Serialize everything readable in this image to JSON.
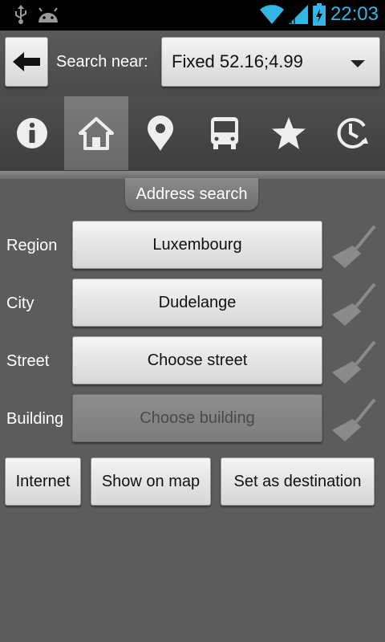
{
  "status_bar": {
    "time": "22:03",
    "icons": [
      "usb-icon",
      "android-icon",
      "wifi-icon",
      "signal-icon",
      "battery-charging-icon"
    ]
  },
  "top_bar": {
    "back_icon": "arrow-left-icon",
    "search_near_label": "Search near:",
    "location_value": "Fixed 52.16;4.99"
  },
  "tabs": [
    {
      "icon": "info-icon",
      "active": false
    },
    {
      "icon": "home-icon",
      "active": true
    },
    {
      "icon": "map-pin-icon",
      "active": false
    },
    {
      "icon": "bus-icon",
      "active": false
    },
    {
      "icon": "star-icon",
      "active": false
    },
    {
      "icon": "history-icon",
      "active": false
    }
  ],
  "section_title": "Address search",
  "fields": [
    {
      "label": "Region",
      "value": "Luxembourg",
      "enabled": true
    },
    {
      "label": "City",
      "value": "Dudelange",
      "enabled": true
    },
    {
      "label": "Street",
      "value": "Choose street",
      "enabled": true
    },
    {
      "label": "Building",
      "value": "Choose building",
      "enabled": false
    }
  ],
  "actions": {
    "internet": "Internet",
    "show_on_map": "Show on map",
    "set_as_destination": "Set as destination"
  },
  "colors": {
    "status_accent": "#33b5e5",
    "background": "#5c5c5c"
  }
}
